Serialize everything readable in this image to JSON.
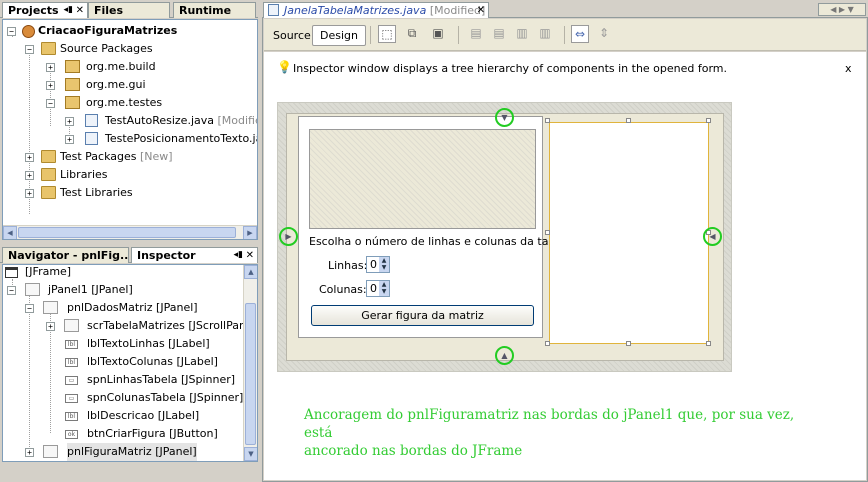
{
  "projects_pane": {
    "tabs": [
      "Projects",
      "Files",
      "Runtime"
    ],
    "tree": {
      "project": "CriacaoFiguraMatrizes",
      "source_packages": "Source Packages",
      "packages": [
        "org.me.build",
        "org.me.gui",
        "org.me.testes"
      ],
      "files": [
        {
          "name": "TestAutoResize.java",
          "suffix": "[Modified]"
        },
        {
          "name": "TestePosicionamentoTexto.java",
          "suffix": ""
        }
      ],
      "test_packages": "Test Packages",
      "test_packages_suffix": "[New]",
      "libraries": "Libraries",
      "test_libraries": "Test Libraries"
    }
  },
  "inspector_pane": {
    "tabs": [
      "Navigator - pnlFig...",
      "Inspector"
    ],
    "tree": [
      "[JFrame]",
      "jPanel1 [JPanel]",
      "pnlDadosMatriz [JPanel]",
      "scrTabelaMatrizes [JScrollPane]",
      "lblTextoLinhas [JLabel]",
      "lblTextoColunas [JLabel]",
      "spnLinhasTabela [JSpinner]",
      "spnColunasTabela [JSpinner]",
      "lblDescricao [JLabel]",
      "btnCriarFigura [JButton]",
      "pnlFiguraMatriz [JPanel]"
    ]
  },
  "editor": {
    "tab_name": "JanelaTabelaMatrizes.java",
    "tab_suffix": "[Modified]",
    "source_label": "Source",
    "design_label": "Design",
    "hint_text": "Inspector window displays a tree hierarchy of components in the opened form.",
    "hint_close": "x"
  },
  "form": {
    "description": "Escolha o número de linhas e colunas da tabela",
    "rows_label": "Linhas:",
    "rows_value": "0",
    "cols_label": "Colunas:",
    "cols_value": "0",
    "button_label": "Gerar figura da matriz"
  },
  "annotation": {
    "line1": "Ancoragem do pnlFiguramatriz nas bordas do jPanel1 que, por sua vez, está",
    "line2": "ancorado nas bordas do JFrame"
  },
  "colors": {
    "annotation_green": "#33cc33",
    "anchor_green": "#22cc22",
    "selection_border": "#e0b43c"
  }
}
